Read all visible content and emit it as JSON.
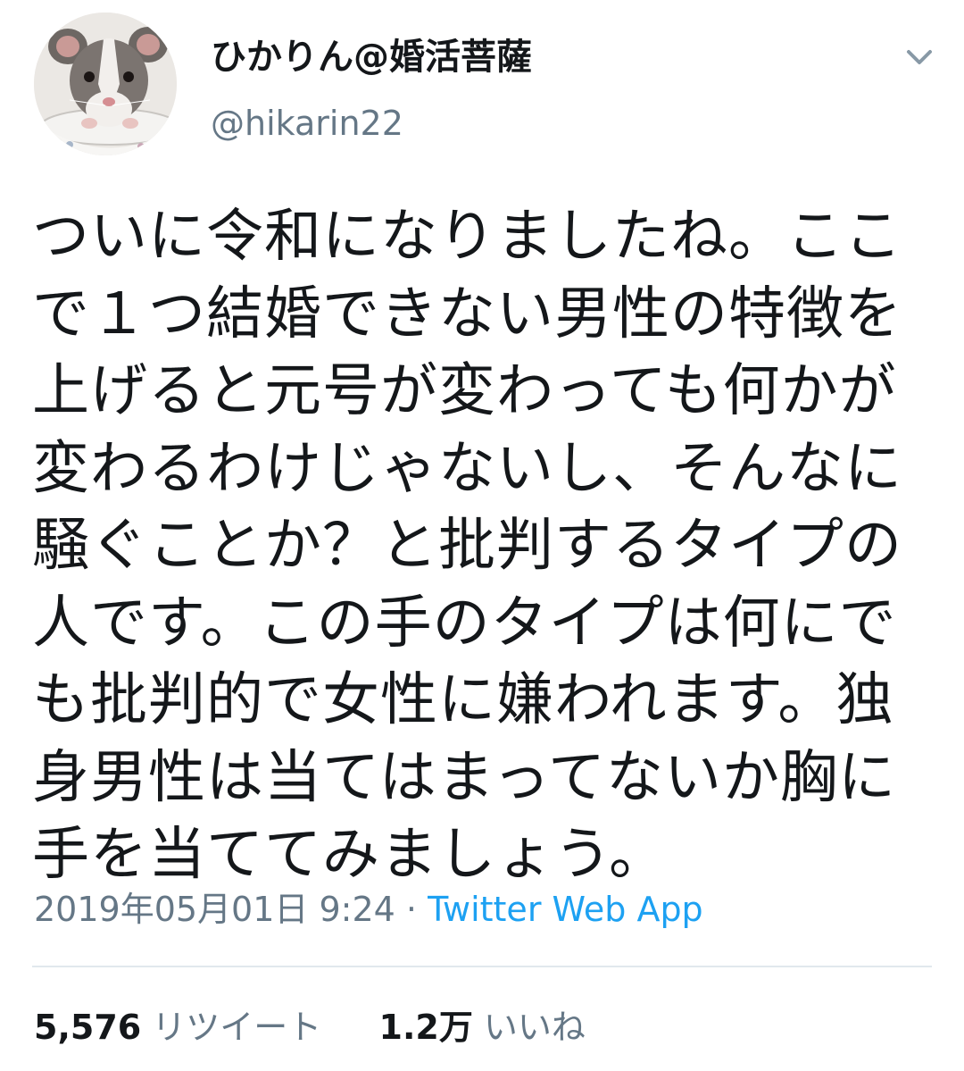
{
  "user": {
    "display_name": "ひかりん@婚活菩薩",
    "handle": "@hikarin22",
    "avatar_icon": "rat-avatar"
  },
  "tweet": {
    "lines": [
      "ついに令和になりましたね。ここ",
      "で１つ結婚できない男性の特徴を",
      "上げると元号が変わっても何かが",
      "変わるわけじゃないし、そんなに",
      "騒ぐことか？と批判するタイプの",
      "人です。この手のタイプは何にで",
      "も批判的で女性に嫌われます。独",
      "身男性は当てはまってないか胸に",
      "手を当ててみましょう。"
    ],
    "timestamp": "2019年05月01日 9:24",
    "separator": " · ",
    "source": "Twitter Web App"
  },
  "stats": {
    "retweets_count": "5,576",
    "retweets_label": "リツイート",
    "likes_count": "1.2万",
    "likes_label": "いいね"
  },
  "colors": {
    "text": "#14171a",
    "secondary": "#657786",
    "link": "#1da1f2",
    "divider": "#e1e8ed"
  },
  "icons": {
    "menu": "chevron-down-icon"
  }
}
